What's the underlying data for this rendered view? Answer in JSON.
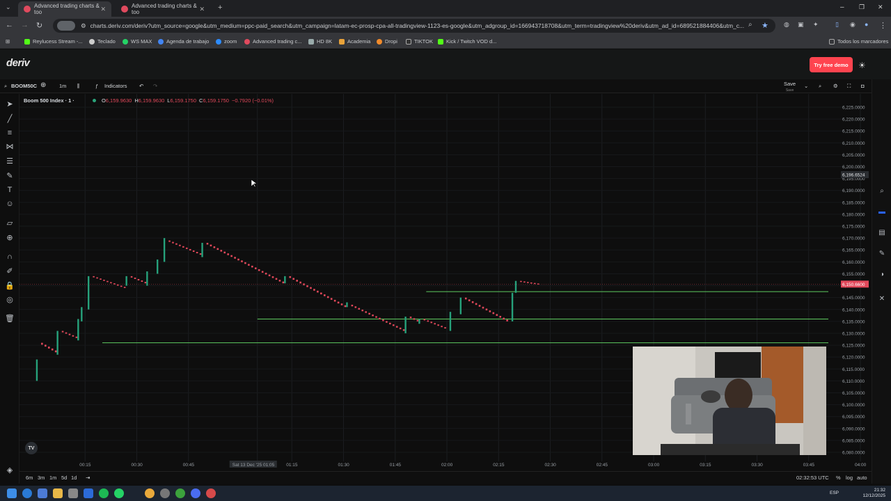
{
  "browser": {
    "tabs": [
      {
        "title": "Advanced trading charts & too",
        "active": true
      },
      {
        "title": "Advanced trading charts & too",
        "active": false
      }
    ],
    "url": "charts.deriv.com/deriv?utm_source=google&utm_medium=ppc-paid_search&utm_campaign=latam-ec-prosp-cpa-all-tradingview-1123-es-google&utm_adgroup_id=166943718708&utm_term=tradingview%20deriv&utm_ad_id=689521884406&utm_c...",
    "bookmarks": [
      "Reylucess Stream -...",
      "Teclado",
      "WS MAX",
      "Agenda de trabajo",
      "zoom",
      "Advanced trading c...",
      "HD 8K",
      "Academia",
      "Dropi",
      "TIKTOK",
      "Kick / Twitch VOD d..."
    ],
    "all_bookmarks": "Todos los marcadores"
  },
  "header": {
    "logo": "deriv",
    "try_demo": "Try free demo"
  },
  "toolbar": {
    "symbol": "BOOM50C",
    "interval": "1m",
    "indicators": "Indicators",
    "save": "Save",
    "save_sub": "Save"
  },
  "legend": {
    "name": "Boom 500 Index · 1 ·",
    "o_label": "O",
    "o": "6,159.9630",
    "h_label": "H",
    "h": "6,159.9630",
    "l_label": "L",
    "l": "6,159.1750",
    "c_label": "C",
    "c": "6,159.1750",
    "change": "−0.7920 (−0.01%)"
  },
  "bottom": {
    "ranges": [
      "6m",
      "3m",
      "1m",
      "5d",
      "1d"
    ],
    "clock": "02:32:53 UTC",
    "pct": "%",
    "log": "log",
    "auto": "auto"
  },
  "taskbar": {
    "lang": "ESP",
    "time": "21:32",
    "date": "12/12/2025"
  },
  "colors": {
    "up": "#26a17b",
    "down": "#e0485a",
    "hline": "#5fcc60",
    "priceline": "#e0485a"
  },
  "chart_data": {
    "type": "candlestick",
    "symbol": "Boom 500 Index",
    "interval": "1m",
    "ylim": [
      6080,
      6225
    ],
    "y_ticks": [
      "6,225.0000",
      "6,220.0000",
      "6,215.0000",
      "6,210.0000",
      "6,205.0000",
      "6,200.0000",
      "6,195.0000",
      "6,190.0000",
      "6,185.0000",
      "6,180.0000",
      "6,175.0000",
      "6,170.0000",
      "6,165.0000",
      "6,160.0000",
      "6,155.0000",
      "6,150.0000",
      "6,145.0000",
      "6,140.0000",
      "6,135.0000",
      "6,130.0000",
      "6,125.0000",
      "6,120.0000",
      "6,115.0000",
      "6,110.0000",
      "6,105.0000",
      "6,100.0000",
      "6,095.0000",
      "6,090.0000",
      "6,085.0000",
      "6,080.0000"
    ],
    "x_ticks": [
      "00:15",
      "00:30",
      "00:45",
      "Sat 13 Dec '25  01:05",
      "01:15",
      "01:30",
      "01:45",
      "02:00",
      "02:15",
      "02:30",
      "02:45",
      "03:00",
      "03:15",
      "03:30",
      "03:45",
      "04:00"
    ],
    "x_tick_minutes": [
      15,
      30,
      45,
      65,
      75,
      90,
      105,
      120,
      135,
      150,
      165,
      180,
      195,
      210,
      225,
      240
    ],
    "crosshair_price_label": "6,196.6524",
    "current_price_label": "6,150.6600",
    "current_price": 6150.66,
    "horizontal_lines": [
      {
        "price": 6147.5,
        "from_minute": 114
      },
      {
        "price": 6136.0,
        "from_minute": 65
      },
      {
        "price": 6126.0,
        "from_minute": 20
      }
    ],
    "segments": [
      {
        "kind": "spike",
        "start_minute": 1,
        "from": 6110,
        "to": 6119
      },
      {
        "kind": "drift",
        "start_minute": 2,
        "end_minute": 7,
        "from": 6126,
        "to": 6122
      },
      {
        "kind": "spike",
        "start_minute": 7,
        "from": 6121,
        "to": 6131
      },
      {
        "kind": "drift",
        "start_minute": 8,
        "end_minute": 13,
        "from": 6131,
        "to": 6128
      },
      {
        "kind": "spike",
        "start_minute": 13,
        "from": 6127,
        "to": 6136
      },
      {
        "kind": "spike",
        "start_minute": 14,
        "from": 6135,
        "to": 6141
      },
      {
        "kind": "spike",
        "start_minute": 16,
        "from": 6140,
        "to": 6154
      },
      {
        "kind": "drift",
        "start_minute": 17,
        "end_minute": 27,
        "from": 6154,
        "to": 6149
      },
      {
        "kind": "spike",
        "start_minute": 27,
        "from": 6150,
        "to": 6154
      },
      {
        "kind": "drift",
        "start_minute": 28,
        "end_minute": 33,
        "from": 6154,
        "to": 6151
      },
      {
        "kind": "spike",
        "start_minute": 33,
        "from": 6150,
        "to": 6156
      },
      {
        "kind": "spike",
        "start_minute": 36,
        "from": 6155,
        "to": 6161
      },
      {
        "kind": "spike",
        "start_minute": 38,
        "from": 6160,
        "to": 6170
      },
      {
        "kind": "drift",
        "start_minute": 39,
        "end_minute": 49,
        "from": 6169,
        "to": 6163
      },
      {
        "kind": "spike",
        "start_minute": 49,
        "from": 6162,
        "to": 6168
      },
      {
        "kind": "drift",
        "start_minute": 50,
        "end_minute": 73,
        "from": 6168,
        "to": 6151
      },
      {
        "kind": "spike",
        "start_minute": 73,
        "from": 6151,
        "to": 6154
      },
      {
        "kind": "drift",
        "start_minute": 74,
        "end_minute": 91,
        "from": 6154,
        "to": 6141
      },
      {
        "kind": "spike",
        "start_minute": 91,
        "from": 6141,
        "to": 6143
      },
      {
        "kind": "drift",
        "start_minute": 92,
        "end_minute": 108,
        "from": 6142,
        "to": 6131
      },
      {
        "kind": "spike",
        "start_minute": 108,
        "from": 6130,
        "to": 6137
      },
      {
        "kind": "drift",
        "start_minute": 109,
        "end_minute": 112,
        "from": 6137,
        "to": 6135
      },
      {
        "kind": "spike",
        "start_minute": 112,
        "from": 6134,
        "to": 6136
      },
      {
        "kind": "drift",
        "start_minute": 113,
        "end_minute": 120,
        "from": 6136,
        "to": 6132
      },
      {
        "kind": "spike",
        "start_minute": 121,
        "from": 6131,
        "to": 6139
      },
      {
        "kind": "spike",
        "start_minute": 124,
        "from": 6138,
        "to": 6145
      },
      {
        "kind": "drift",
        "start_minute": 125,
        "end_minute": 138,
        "from": 6145,
        "to": 6135
      },
      {
        "kind": "spike",
        "start_minute": 139,
        "from": 6135,
        "to": 6147
      },
      {
        "kind": "spike",
        "start_minute": 140,
        "from": 6147,
        "to": 6152
      },
      {
        "kind": "drift",
        "start_minute": 141,
        "end_minute": 147,
        "from": 6152,
        "to": 6150.7
      }
    ]
  }
}
